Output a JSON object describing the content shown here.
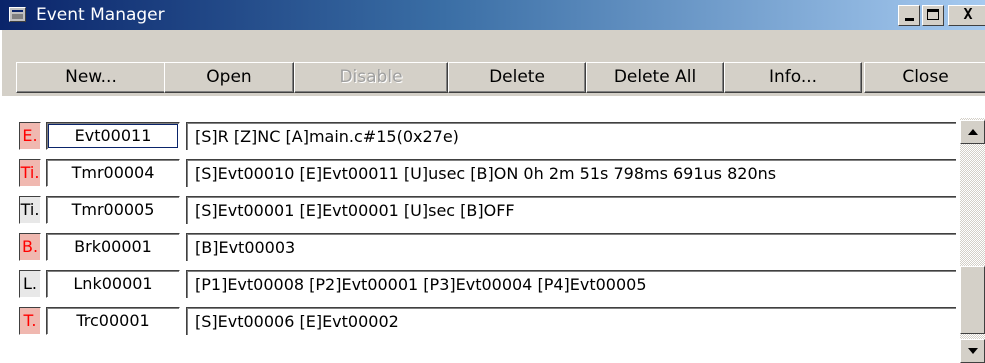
{
  "window": {
    "title": "Event Manager",
    "icon": "event-manager-app-icon",
    "controls": {
      "minimize": "minimize-icon",
      "maximize": "maximize-icon",
      "close": "close-icon",
      "close_glyph": "X"
    }
  },
  "toolbar": {
    "new_label": "New...",
    "open_label": "Open",
    "disable_label": "Disable",
    "delete_label": "Delete",
    "delete_all_label": "Delete All",
    "info_label": "Info...",
    "close_label": "Close"
  },
  "events": [
    {
      "type": "E.",
      "type_color": "red",
      "id": "Evt00011",
      "description": "[S]R [Z]NC [A]main.c#15(0x27e)",
      "selected": true
    },
    {
      "type": "Ti.",
      "type_color": "red",
      "id": "Tmr00004",
      "description": "[S]Evt00010 [E]Evt00011 [U]usec [B]ON 0h 2m 51s 798ms 691us 820ns"
    },
    {
      "type": "Ti.",
      "type_color": "dark",
      "id": "Tmr00005",
      "description": "[S]Evt00001 [E]Evt00001 [U]sec [B]OFF"
    },
    {
      "type": "B.",
      "type_color": "red",
      "id": "Brk00001",
      "description": "[B]Evt00003"
    },
    {
      "type": "L.",
      "type_color": "dark",
      "id": "Lnk00001",
      "description": "[P1]Evt00008 [P2]Evt00001 [P3]Evt00004 [P4]Evt00005"
    },
    {
      "type": "T.",
      "type_color": "red",
      "id": "Trc00001",
      "description": "[S]Evt00006 [E]Evt00002"
    }
  ],
  "colors": {
    "title_start": "#0a246a",
    "title_end": "#a6caf0",
    "face": "#d4d0c8",
    "type_red": "#ff0000"
  }
}
